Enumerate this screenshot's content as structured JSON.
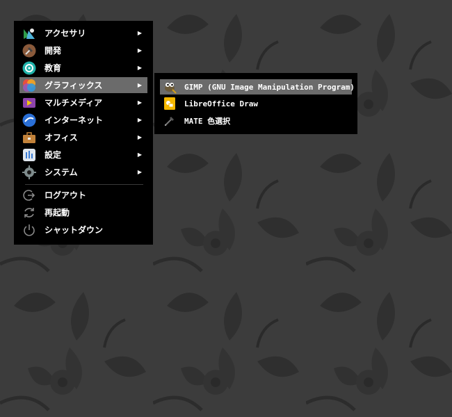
{
  "colors": {
    "menu_bg": "#000000",
    "highlight": "#6b6b6b",
    "text": "#ffffff",
    "wallpaper": "#3b3b3b"
  },
  "menu": {
    "categories": [
      {
        "label": "アクセサリ",
        "icon": "accessories-icon",
        "has_submenu": true
      },
      {
        "label": "開発",
        "icon": "development-icon",
        "has_submenu": true
      },
      {
        "label": "教育",
        "icon": "education-icon",
        "has_submenu": true
      },
      {
        "label": "グラフィックス",
        "icon": "graphics-icon",
        "has_submenu": true,
        "active": true
      },
      {
        "label": "マルチメディア",
        "icon": "multimedia-icon",
        "has_submenu": true
      },
      {
        "label": "インターネット",
        "icon": "internet-icon",
        "has_submenu": true
      },
      {
        "label": "オフィス",
        "icon": "office-icon",
        "has_submenu": true
      },
      {
        "label": "設定",
        "icon": "settings-icon",
        "has_submenu": true
      },
      {
        "label": "システム",
        "icon": "system-icon",
        "has_submenu": true
      }
    ],
    "session": [
      {
        "label": "ログアウト",
        "icon": "logout-icon"
      },
      {
        "label": "再起動",
        "icon": "restart-icon"
      },
      {
        "label": "シャットダウン",
        "icon": "shutdown-icon"
      }
    ],
    "submenu_arrow": "▶"
  },
  "submenu": {
    "items": [
      {
        "label": "GIMP (GNU Image Manipulation Program)",
        "icon": "gimp-icon",
        "active": true
      },
      {
        "label": "LibreOffice Draw",
        "icon": "libreoffice-draw-icon"
      },
      {
        "label": "MATE 色選択",
        "icon": "color-picker-icon"
      }
    ]
  }
}
